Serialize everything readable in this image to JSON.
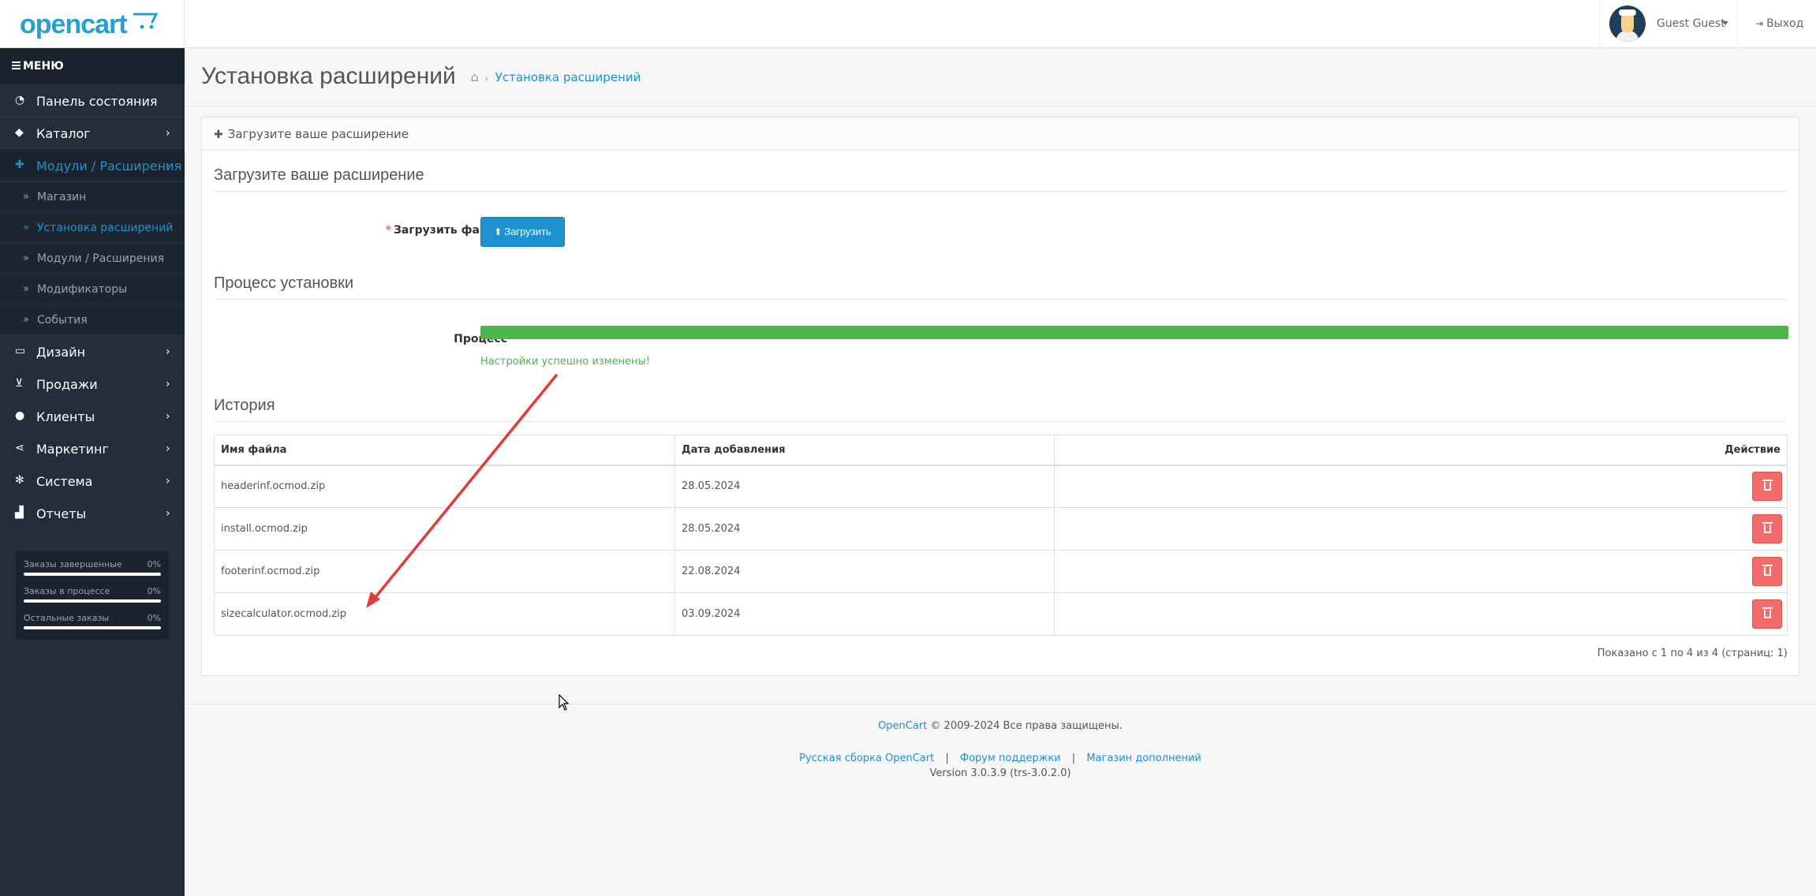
{
  "header": {
    "logo_text": "opencart",
    "user_name": "Guest Guest",
    "logout_label": "Выход"
  },
  "sidebar": {
    "menu_label": "МЕНЮ",
    "items": [
      {
        "label": "Панель состояния",
        "icon": "dashboard-icon",
        "arrow": ""
      },
      {
        "label": "Каталог",
        "icon": "tags-icon",
        "arrow": "›"
      },
      {
        "label": "Модули / Расширения",
        "icon": "puzzle-icon",
        "arrow": "›",
        "active": true
      },
      {
        "label": "Дизайн",
        "icon": "monitor-icon",
        "arrow": "›"
      },
      {
        "label": "Продажи",
        "icon": "cart-icon",
        "arrow": "›"
      },
      {
        "label": "Клиенты",
        "icon": "user-icon",
        "arrow": "›"
      },
      {
        "label": "Маркетинг",
        "icon": "share-icon",
        "arrow": "›"
      },
      {
        "label": "Система",
        "icon": "gear-icon",
        "arrow": "›"
      },
      {
        "label": "Отчеты",
        "icon": "bar-chart-icon",
        "arrow": "›"
      }
    ],
    "subitems": [
      {
        "label": "Магазин"
      },
      {
        "label": "Установка расширений",
        "active": true
      },
      {
        "label": "Модули / Расширения"
      },
      {
        "label": "Модификаторы"
      },
      {
        "label": "События"
      }
    ],
    "stats": [
      {
        "label": "Заказы завершенные",
        "value": "0%"
      },
      {
        "label": "Заказы в процессе",
        "value": "0%"
      },
      {
        "label": "Остальные заказы",
        "value": "0%"
      }
    ]
  },
  "page": {
    "title": "Установка расширений",
    "breadcrumb": "Установка расширений",
    "panel_title": "Загрузите ваше расширение",
    "upload_legend": "Загрузите ваше расширение",
    "upload_label": "Загрузить файл",
    "upload_button": "Загрузить",
    "process_legend": "Процесс установки",
    "process_label": "Процесс",
    "progress_percent": 100,
    "progress_text": "Настройки успешно изменены!",
    "history_legend": "История",
    "columns": [
      "Имя файла",
      "Дата добавления",
      "Действие"
    ],
    "rows": [
      {
        "filename": "headerinf.ocmod.zip",
        "date": "28.05.2024"
      },
      {
        "filename": "install.ocmod.zip",
        "date": "28.05.2024"
      },
      {
        "filename": "footerinf.ocmod.zip",
        "date": "22.08.2024"
      },
      {
        "filename": "sizecalculator.ocmod.zip",
        "date": "03.09.2024"
      }
    ],
    "pagination": "Показано с 1 по 4 из 4 (страниц: 1)"
  },
  "footer": {
    "brand_link": "OpenCart",
    "copyright": " © 2009-2024 Все права защищены.",
    "link_ru": "Русская сборка OpenCart",
    "link_forum": "Форум поддержки",
    "link_store": "Магазин дополнений",
    "separator": "|",
    "version": "Version 3.0.3.9 (trs-3.0.2.0)"
  },
  "colors": {
    "accent": "#1e91cf",
    "sidebar": "#242e3a",
    "success": "#4cb64c",
    "danger": "#f56b6b",
    "annotation_arrow": "#e03c3c"
  }
}
